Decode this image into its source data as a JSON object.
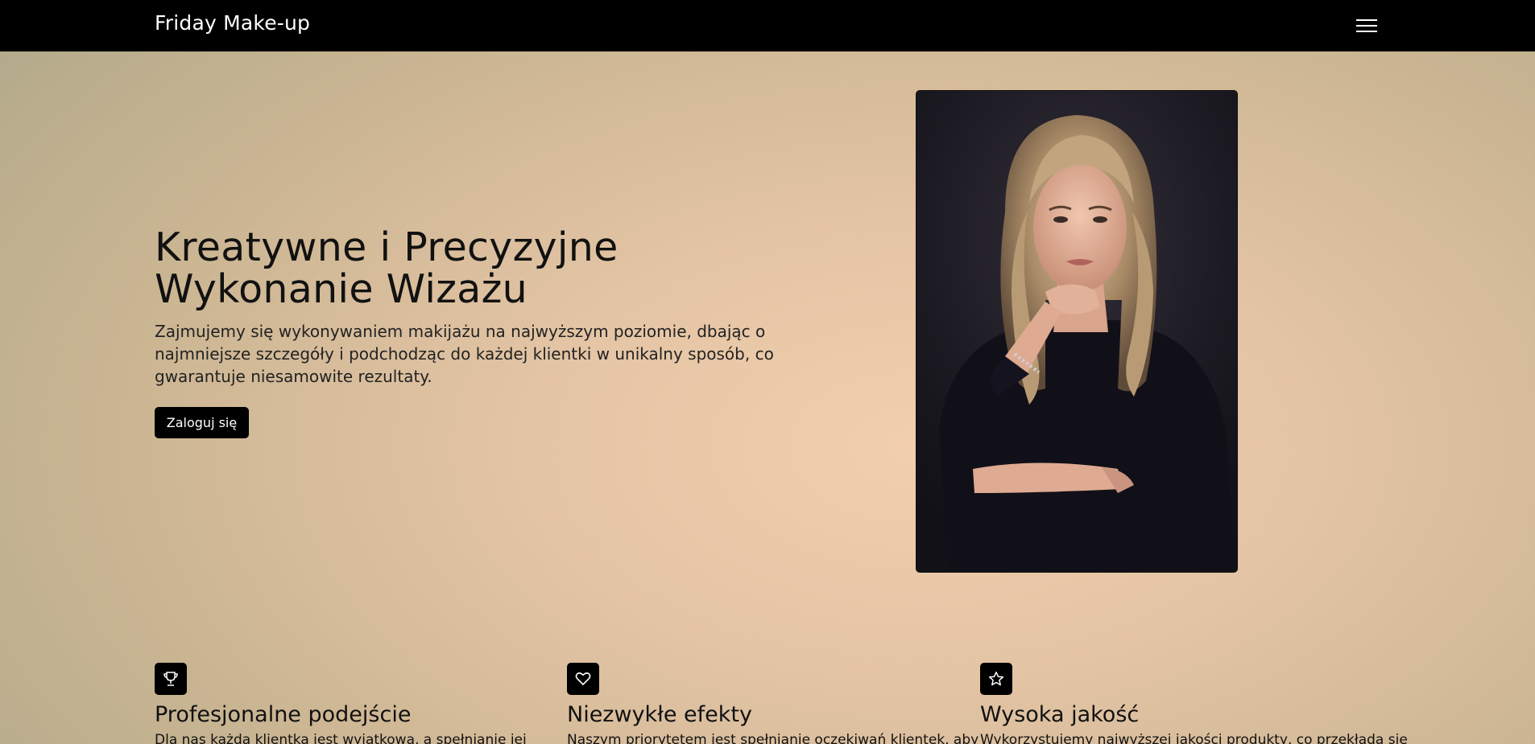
{
  "navbar": {
    "brand": "Friday Make-up",
    "menu_icon": "hamburger-menu-icon"
  },
  "hero": {
    "title": "Kreatywne i Precyzyjne Wykonanie Wizażu",
    "description": "Zajmujemy się wykonywaniem makijażu na najwyższym poziomie, dbając o najmniejsze szczegóły i podchodząc do każdej klientki w unikalny sposób, co gwarantuje niesamowite rezultaty.",
    "cta_label": "Zaloguj się",
    "photo_subject": "portrait-of-woman"
  },
  "features": [
    {
      "icon": "trophy-icon",
      "title": "Profesjonalne podejście",
      "text": "Dla nas każda klientka jest wyjątkowa, a spełnianie jej"
    },
    {
      "icon": "heart-icon",
      "title": "Niezwykłe efekty",
      "text": "Naszym priorytetem jest spełnianie oczekiwań klientek, aby"
    },
    {
      "icon": "star-icon",
      "title": "Wysoka jakość",
      "text": "Wykorzystujemy najwyższej jakości produkty, co przekłada się"
    }
  ],
  "colors": {
    "navbar": "#000000",
    "background_center": "#f2cfae",
    "background_edge": "#b3aa8b",
    "button": "#000000",
    "text": "#111111"
  }
}
